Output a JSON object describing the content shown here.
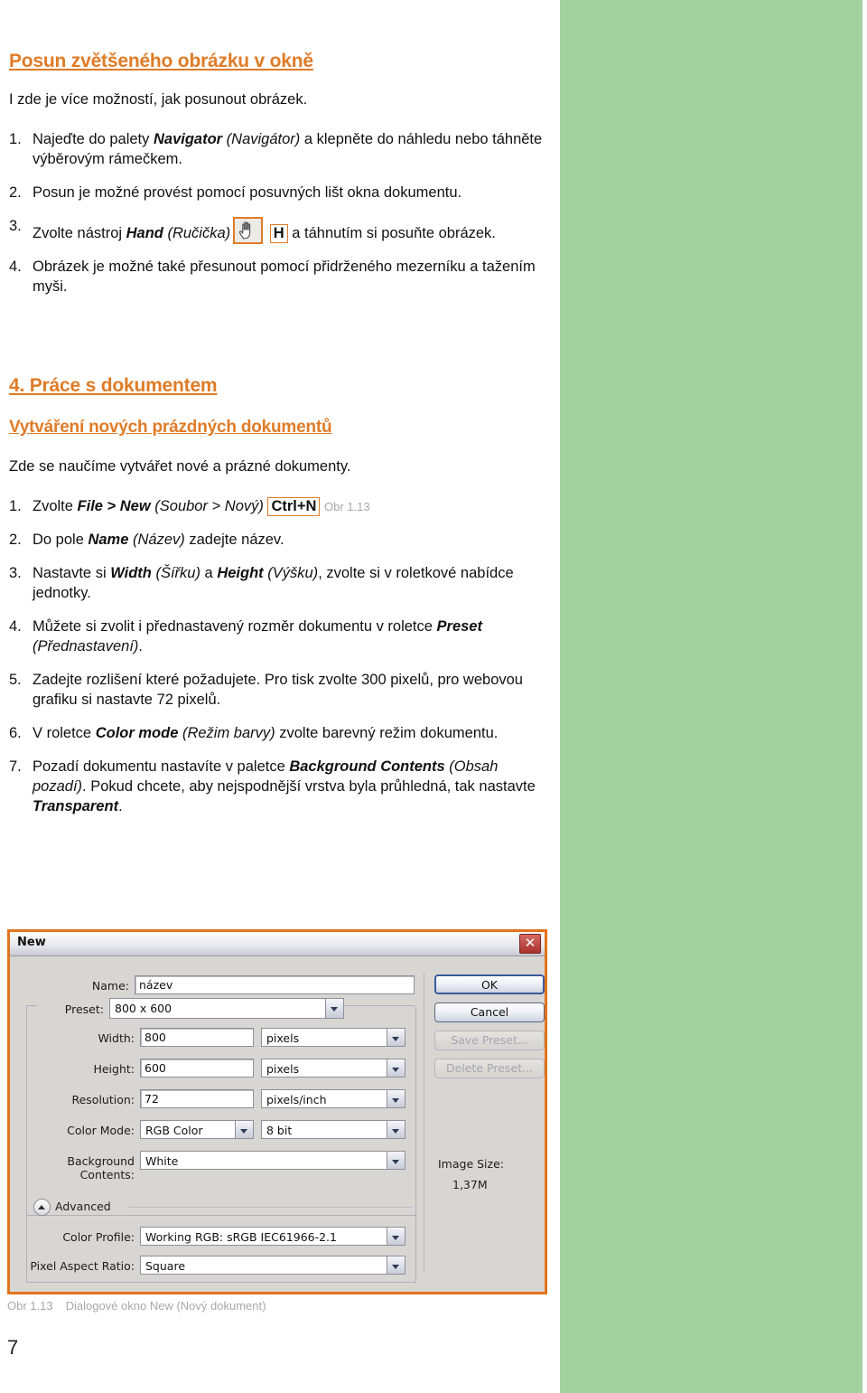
{
  "page": {
    "number": "7",
    "accent_color": "#e07b26",
    "band_color": "#a4d1a0"
  },
  "section_a": {
    "heading": "Posun zvětšeného obrázku v okně",
    "intro": "I zde je více možností, jak posunout obrázek.",
    "steps": [
      {
        "num": "1.",
        "parts": [
          {
            "t": "Najeďte do palety ",
            "s": "plain"
          },
          {
            "t": "Navigator",
            "s": "bold-italic"
          },
          {
            "t": " (Navigátor)",
            "s": "italic"
          },
          {
            "t": " a klepněte do náhledu nebo táhněte výběrovým rámečkem.",
            "s": "plain"
          }
        ]
      },
      {
        "num": "2.",
        "parts": [
          {
            "t": "Posun je možné provést pomocí posuvných lišt okna dokumentu.",
            "s": "plain"
          }
        ]
      },
      {
        "num": "3.",
        "parts": [
          {
            "t": "Zvolte nástroj ",
            "s": "plain"
          },
          {
            "t": "Hand",
            "s": "bold-italic"
          },
          {
            "t": " (Ručička)",
            "s": "italic"
          },
          {
            "t": "ICON:hand-tool",
            "s": "icon"
          },
          {
            "t": "H",
            "s": "kbd"
          },
          {
            "t": " a táhnutím si posuňte obrázek.",
            "s": "plain"
          }
        ]
      },
      {
        "num": "4.",
        "parts": [
          {
            "t": "Obrázek je možné také přesunout pomocí přidrženého mezerníku a tažením myši.",
            "s": "plain"
          }
        ]
      }
    ]
  },
  "section_b": {
    "heading": "4. Práce s dokumentem",
    "subheading": "Vytváření nových prázdných dokumentů",
    "intro": "Zde se naučíme vytvářet nové a prázné dokumenty.",
    "steps": [
      {
        "num": "1.",
        "parts": [
          {
            "t": "Zvolte ",
            "s": "plain"
          },
          {
            "t": "File > New",
            "s": "bold-italic"
          },
          {
            "t": " (Soubor > Nový)",
            "s": "italic"
          },
          {
            "t": "Ctrl+N",
            "s": "kbd"
          },
          {
            "t": "Obr 1.13",
            "s": "figref"
          }
        ]
      },
      {
        "num": "2.",
        "parts": [
          {
            "t": "Do pole ",
            "s": "plain"
          },
          {
            "t": "Name",
            "s": "bold-italic"
          },
          {
            "t": " (Název)",
            "s": "italic"
          },
          {
            "t": " zadejte název.",
            "s": "plain"
          }
        ]
      },
      {
        "num": "3.",
        "parts": [
          {
            "t": "Nastavte si ",
            "s": "plain"
          },
          {
            "t": "Width",
            "s": "bold-italic"
          },
          {
            "t": " (Šířku)",
            "s": "italic"
          },
          {
            "t": " a ",
            "s": "plain"
          },
          {
            "t": "Height",
            "s": "bold-italic"
          },
          {
            "t": " (Výšku)",
            "s": "italic"
          },
          {
            "t": ", zvolte si v roletkové nabídce jednotky.",
            "s": "plain"
          }
        ]
      },
      {
        "num": "4.",
        "parts": [
          {
            "t": "Můžete si zvolit i přednastavený rozměr dokumentu v roletce ",
            "s": "plain"
          },
          {
            "t": "Preset",
            "s": "bold-italic"
          },
          {
            "t": " (Přednastavení)",
            "s": "italic"
          },
          {
            "t": ".",
            "s": "plain"
          }
        ]
      },
      {
        "num": "5.",
        "parts": [
          {
            "t": "Zadejte rozlišení které požadujete. Pro tisk zvolte 300 pixelů, pro webovou grafiku si nastavte 72 pixelů.",
            "s": "plain"
          }
        ]
      },
      {
        "num": "6.",
        "parts": [
          {
            "t": "V roletce ",
            "s": "plain"
          },
          {
            "t": "Color mode",
            "s": "bold-italic"
          },
          {
            "t": " (Režim barvy)",
            "s": "italic"
          },
          {
            "t": " zvolte barevný režim dokumentu.",
            "s": "plain"
          }
        ]
      },
      {
        "num": "7.",
        "parts": [
          {
            "t": "Pozadí dokumentu nastavíte v paletce ",
            "s": "plain"
          },
          {
            "t": "Background Contents",
            "s": "bold-italic"
          },
          {
            "t": " (Obsah pozadí)",
            "s": "italic"
          },
          {
            "t": ". Pokud chcete, aby nejspodnější vrstva byla průhledná, tak nastavte ",
            "s": "plain"
          },
          {
            "t": "Transparent",
            "s": "bold-italic"
          },
          {
            "t": ".",
            "s": "plain"
          }
        ]
      }
    ]
  },
  "dialog": {
    "title": "New",
    "close_icon": "close-icon",
    "fields": {
      "name_label": "Name:",
      "name_value": "název",
      "preset_label": "Preset:",
      "preset_value": "800 x 600",
      "width_label": "Width:",
      "width_value": "800",
      "width_unit": "pixels",
      "height_label": "Height:",
      "height_value": "600",
      "height_unit": "pixels",
      "resolution_label": "Resolution:",
      "resolution_value": "72",
      "resolution_unit": "pixels/inch",
      "colormode_label": "Color Mode:",
      "colormode_value": "RGB Color",
      "colordepth_value": "8 bit",
      "background_label": "Background Contents:",
      "background_value": "White",
      "advanced_label": "Advanced",
      "colorprofile_label": "Color Profile:",
      "colorprofile_value": "Working RGB:  sRGB IEC61966-2.1",
      "pixelaspect_label": "Pixel Aspect Ratio:",
      "pixelaspect_value": "Square"
    },
    "buttons": {
      "ok": "OK",
      "cancel": "Cancel",
      "save_preset": "Save Preset...",
      "delete_preset": "Delete Preset..."
    },
    "info": {
      "image_size_label": "Image Size:",
      "image_size_value": "1,37M"
    }
  },
  "figure": {
    "id": "Obr 1.13",
    "caption": "Dialogové okno New (Nový dokument)"
  }
}
